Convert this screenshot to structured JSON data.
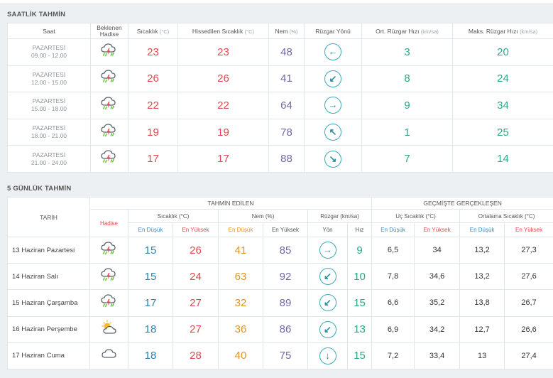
{
  "hourly": {
    "title": "SAATLİK TAHMİN",
    "headers": {
      "time": "Saat",
      "event_line1": "Beklenen",
      "event_line2": "Hadise",
      "temp": "Sıcaklık",
      "temp_unit": "(°C)",
      "feels": "Hissedilen Sıcaklık",
      "feels_unit": "(°C)",
      "humidity": "Nem",
      "humidity_unit": "(%)",
      "wind_dir": "Rüzgar Yönü",
      "avg_wind": "Ort. Rüzgar Hızı",
      "avg_wind_unit": "(km/sa)",
      "max_wind": "Maks. Rüzgar Hızı",
      "max_wind_unit": "(km/sa)"
    },
    "rows": [
      {
        "day": "PAZARTESİ",
        "range": "09.00 - 12.00",
        "icon": "thunder-rain-icon",
        "temp": "23",
        "feels": "23",
        "humidity": "48",
        "dir_glyph": "←",
        "dir_icon": "wind-west-icon",
        "avg": "3",
        "max": "20"
      },
      {
        "day": "PAZARTESİ",
        "range": "12.00 - 15.00",
        "icon": "thunder-rain-icon",
        "temp": "26",
        "feels": "26",
        "humidity": "41",
        "dir_glyph": "↙",
        "dir_icon": "wind-southwest-icon",
        "avg": "8",
        "max": "24"
      },
      {
        "day": "PAZARTESİ",
        "range": "15.00 - 18.00",
        "icon": "thunder-rain-icon",
        "temp": "22",
        "feels": "22",
        "humidity": "64",
        "dir_glyph": "→",
        "dir_icon": "wind-east-icon",
        "avg": "9",
        "max": "34"
      },
      {
        "day": "PAZARTESİ",
        "range": "18.00 - 21.00",
        "icon": "thunder-rain-icon",
        "temp": "19",
        "feels": "19",
        "humidity": "78",
        "dir_glyph": "↖",
        "dir_icon": "wind-northwest-icon",
        "avg": "1",
        "max": "25"
      },
      {
        "day": "PAZARTESİ",
        "range": "21.00 - 24.00",
        "icon": "thunder-rain-icon",
        "temp": "17",
        "feels": "17",
        "humidity": "88",
        "dir_glyph": "↘",
        "dir_icon": "wind-southeast-icon",
        "avg": "7",
        "max": "14"
      }
    ]
  },
  "daily": {
    "title": "5 GÜNLÜK TAHMİN",
    "headers": {
      "forecast": "TAHMİN EDİLEN",
      "past": "GEÇMİŞTE GERÇEKLEŞEN",
      "date": "TARİH",
      "event": "Hadise",
      "temp": "Sıcaklık (°C)",
      "humidity": "Nem (%)",
      "wind": "Rüzgar (km/sa)",
      "extreme": "Uç Sıcaklık (°C)",
      "average": "Ortalama Sıcaklık (°C)",
      "min": "En Düşük",
      "max": "En Yüksek",
      "dir": "Yön",
      "speed": "Hız"
    },
    "rows": [
      {
        "date": "13 Haziran Pazartesi",
        "icon": "thunder-rain-icon",
        "tmin": "15",
        "tmax": "26",
        "hmin": "41",
        "hmax": "85",
        "dir_glyph": "→",
        "dir_icon": "wind-east-icon",
        "speed": "9",
        "umin": "6,5",
        "umax": "34",
        "amin": "13,2",
        "amax": "27,3"
      },
      {
        "date": "14 Haziran Salı",
        "icon": "thunder-rain-icon",
        "tmin": "15",
        "tmax": "24",
        "hmin": "63",
        "hmax": "92",
        "dir_glyph": "↙",
        "dir_icon": "wind-southwest-icon",
        "speed": "10",
        "umin": "7,8",
        "umax": "34,6",
        "amin": "13,2",
        "amax": "27,6"
      },
      {
        "date": "15 Haziran Çarşamba",
        "icon": "thunder-rain-icon",
        "tmin": "17",
        "tmax": "27",
        "hmin": "32",
        "hmax": "89",
        "dir_glyph": "↙",
        "dir_icon": "wind-southwest-icon",
        "speed": "15",
        "umin": "6,6",
        "umax": "35,2",
        "amin": "13,8",
        "amax": "26,7"
      },
      {
        "date": "16 Haziran Perşembe",
        "icon": "partly-cloudy-icon",
        "tmin": "18",
        "tmax": "27",
        "hmin": "36",
        "hmax": "86",
        "dir_glyph": "↙",
        "dir_icon": "wind-southwest-icon",
        "speed": "13",
        "umin": "6,9",
        "umax": "34,2",
        "amin": "12,7",
        "amax": "26,6"
      },
      {
        "date": "17 Haziran Cuma",
        "icon": "cloudy-icon",
        "tmin": "18",
        "tmax": "28",
        "hmin": "40",
        "hmax": "75",
        "dir_glyph": "↓",
        "dir_icon": "wind-south-icon",
        "speed": "15",
        "umin": "7,2",
        "umax": "33,4",
        "amin": "13",
        "amax": "27,4"
      }
    ]
  }
}
